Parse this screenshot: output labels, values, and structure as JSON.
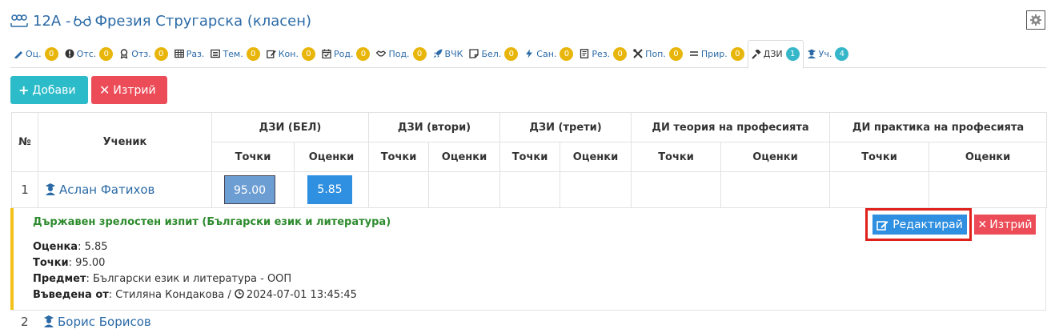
{
  "header": {
    "class": "12А",
    "separator": "-",
    "teacher": "Фрезия Стругарска (класен)"
  },
  "tabs": [
    {
      "label": "Оц.",
      "badge": "0",
      "icon": "pencil-icon"
    },
    {
      "label": "Отс.",
      "badge": "0",
      "icon": "exclamation-circle-icon"
    },
    {
      "label": "Отз.",
      "badge": "0",
      "icon": "award-icon"
    },
    {
      "label": "Раз.",
      "icon": "table-icon"
    },
    {
      "label": "Тем.",
      "badge": "0",
      "icon": "list-icon"
    },
    {
      "label": "Кон.",
      "badge": "0",
      "icon": "edit-icon"
    },
    {
      "label": "Род.",
      "badge": "0",
      "icon": "calendar-check-icon"
    },
    {
      "label": "Под.",
      "badge": "0",
      "icon": "handshake-icon"
    },
    {
      "label": "ВЧК",
      "icon": "rocket-icon"
    },
    {
      "label": "Бел.",
      "badge": "0",
      "icon": "sticky-note-icon"
    },
    {
      "label": "Сан.",
      "badge": "0",
      "icon": "bolt-icon"
    },
    {
      "label": "Рез.",
      "badge": "0",
      "icon": "file-icon"
    },
    {
      "label": "Поп.",
      "badge": "0",
      "icon": "tools-icon"
    },
    {
      "label": "Прир.",
      "badge": "0",
      "icon": "equals-icon"
    },
    {
      "label": "ДЗИ",
      "badge": "1",
      "icon": "gavel-icon",
      "active": true
    },
    {
      "label": "Уч.",
      "badge": "4",
      "icon": "user-graduate-icon"
    }
  ],
  "actions": {
    "add": "Добави",
    "delete": "Изтрий"
  },
  "table": {
    "col_num": "№",
    "col_student": "Ученик",
    "groups": [
      "ДЗИ (БЕЛ)",
      "ДЗИ (втори)",
      "ДЗИ (трети)",
      "ДИ теория на професията",
      "ДИ практика на професията"
    ],
    "sub_points": "Точки",
    "sub_marks": "Оценки",
    "rows": [
      {
        "num": "1",
        "student": "Аслан Фатихов",
        "bel_points": "95.00",
        "bel_mark": "5.85"
      },
      {
        "num": "2",
        "student": "Борис Борисов"
      }
    ]
  },
  "detail": {
    "title": "Държавен зрелостен изпит (Български език и литература)",
    "mark_label": "Оценка",
    "mark_value": ": 5.85",
    "points_label": "Точки",
    "points_value": ": 95.00",
    "subject_label": "Предмет",
    "subject_value": ": Български език и литература - ООП",
    "entered_label": "Въведена от",
    "entered_by": ": Стиляна Кондакова / ",
    "entered_at": "2024-07-01 13:45:45",
    "edit_button": "Редактирай",
    "delete_button": "Изтрий"
  },
  "colors": {
    "accent": "#2b6aa6",
    "badge": "#e8b60a",
    "badge_active": "#36b6c9",
    "add": "#2bbbc9",
    "danger": "#ec4c57",
    "primary": "#2f8fe0",
    "highlight": "#e0201b"
  }
}
